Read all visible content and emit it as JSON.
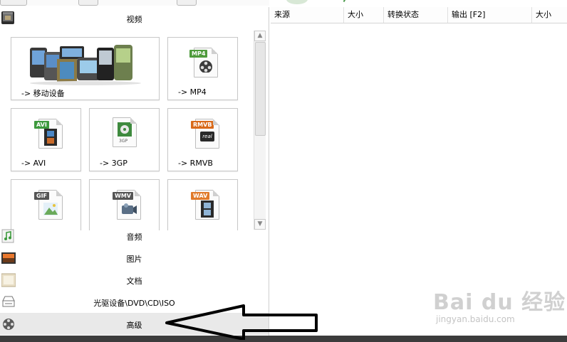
{
  "categories": {
    "video": "视频",
    "audio": "音频",
    "image": "图片",
    "document": "文档",
    "rom": "光驱设备\\DVD\\CD\\ISO",
    "advanced": "高级"
  },
  "video_formats": [
    {
      "label": "-> 移动设备"
    },
    {
      "label": "-> MP4",
      "tag": "MP4"
    },
    {
      "label": "-> AVI",
      "tag": "AVI"
    },
    {
      "label": "-> 3GP",
      "sub": "3GP"
    },
    {
      "label": "-> RMVB",
      "tag": "RMVB",
      "sub": "real"
    },
    {
      "tag": "GIF"
    },
    {
      "tag": "WMV"
    },
    {
      "tag": "WAV"
    }
  ],
  "table": {
    "columns": [
      "来源",
      "大小",
      "转换状态",
      "输出 [F2]",
      "大小"
    ]
  },
  "scrollbar": {
    "up": "▲",
    "down": "▼"
  },
  "watermark": {
    "logo": "Bai du 经验",
    "url": "jingyan.baidu.com"
  },
  "colors": {
    "mp4_tag": "#4f9b3c",
    "avi_tag": "#3e9a3e",
    "rmvb_tag": "#d96a1a",
    "gif_tag": "#555555",
    "wmv_tag": "#555555",
    "wav_tag": "#e07a2a",
    "arrow": "#000000"
  }
}
